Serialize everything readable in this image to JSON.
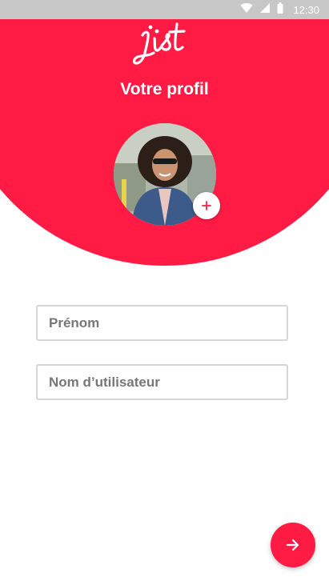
{
  "status_bar": {
    "time": "12:30",
    "icons": [
      "wifi-icon",
      "signal-icon",
      "battery-icon"
    ]
  },
  "brand": {
    "logo_text": "jist",
    "accent_color": "#ff1b44"
  },
  "header": {
    "title": "Votre profil"
  },
  "profile": {
    "avatar": "user-photo",
    "add_photo_icon": "plus-icon"
  },
  "form": {
    "first_name": {
      "placeholder": "Prénom",
      "value": ""
    },
    "username": {
      "placeholder": "Nom d’utilisateur",
      "value": ""
    }
  },
  "actions": {
    "next_icon": "arrow-right-icon"
  }
}
